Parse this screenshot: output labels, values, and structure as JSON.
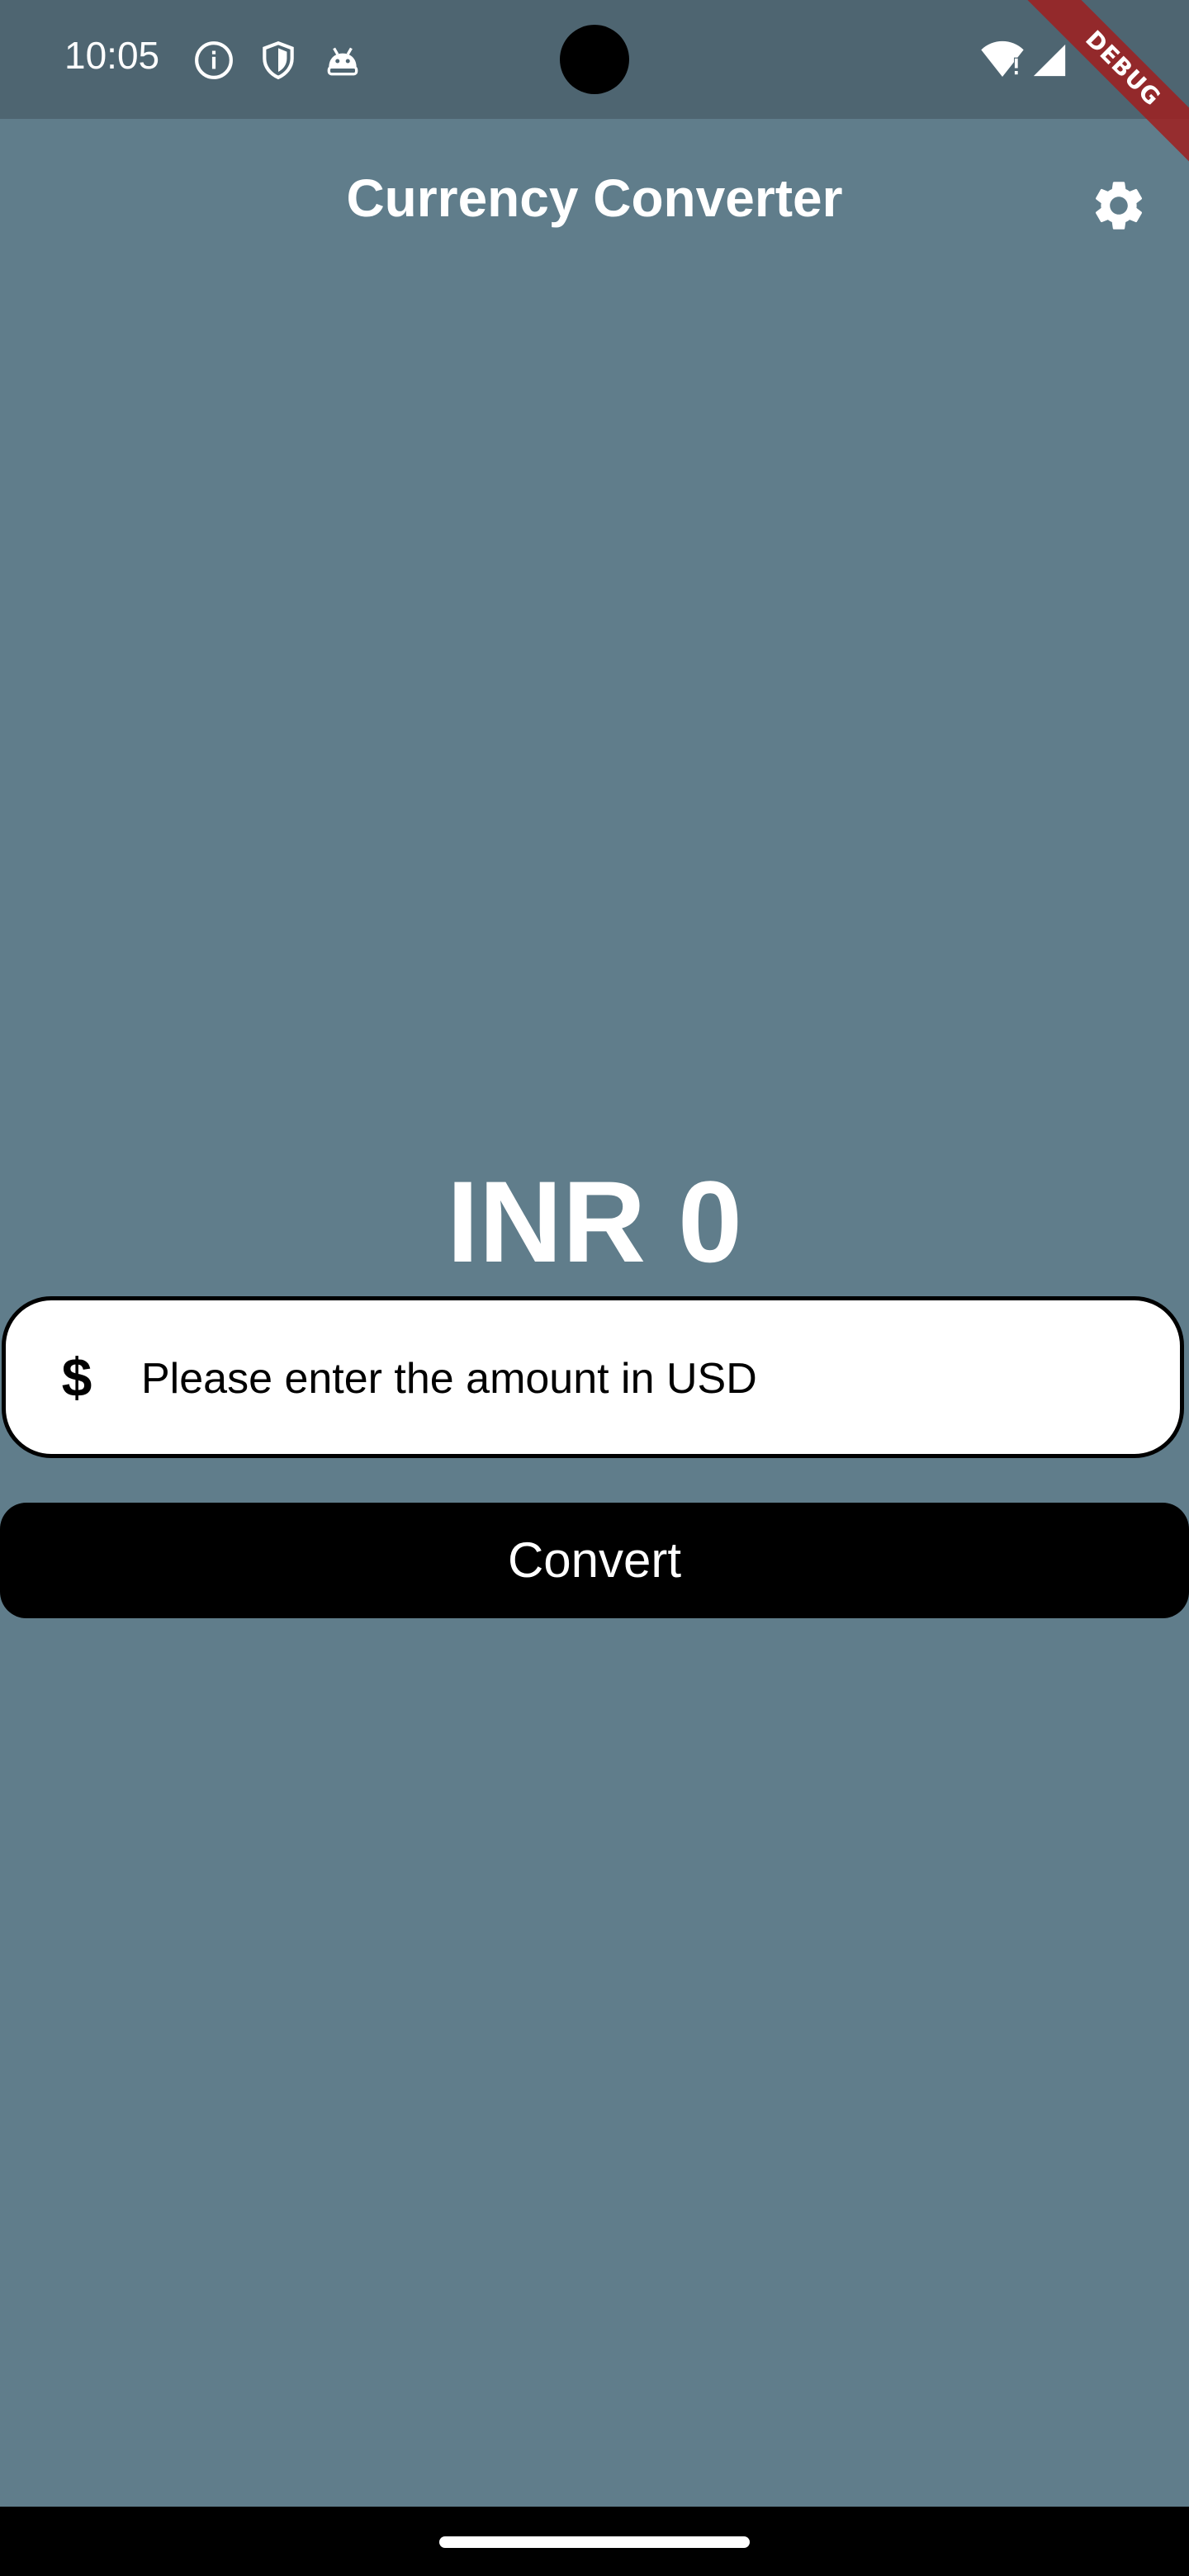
{
  "status_bar": {
    "time": "10:05",
    "icons": [
      "info-icon",
      "shield-icon",
      "android-icon",
      "wifi-icon",
      "signal-icon"
    ]
  },
  "debug_banner": {
    "label": "DEBUG",
    "color": "#a01e1e"
  },
  "app_bar": {
    "title": "Currency Converter",
    "settings_icon": "gear-icon"
  },
  "result": {
    "text": "INR 0"
  },
  "amount_field": {
    "prefix_icon": "$",
    "placeholder": "Please enter the amount in USD",
    "value": ""
  },
  "convert_button": {
    "label": "Convert"
  },
  "colors": {
    "background": "#607d8b",
    "status_bar": "#4e6571",
    "button": "#000000",
    "field_background": "#ffffff",
    "text_on_dark": "#ffffff"
  }
}
